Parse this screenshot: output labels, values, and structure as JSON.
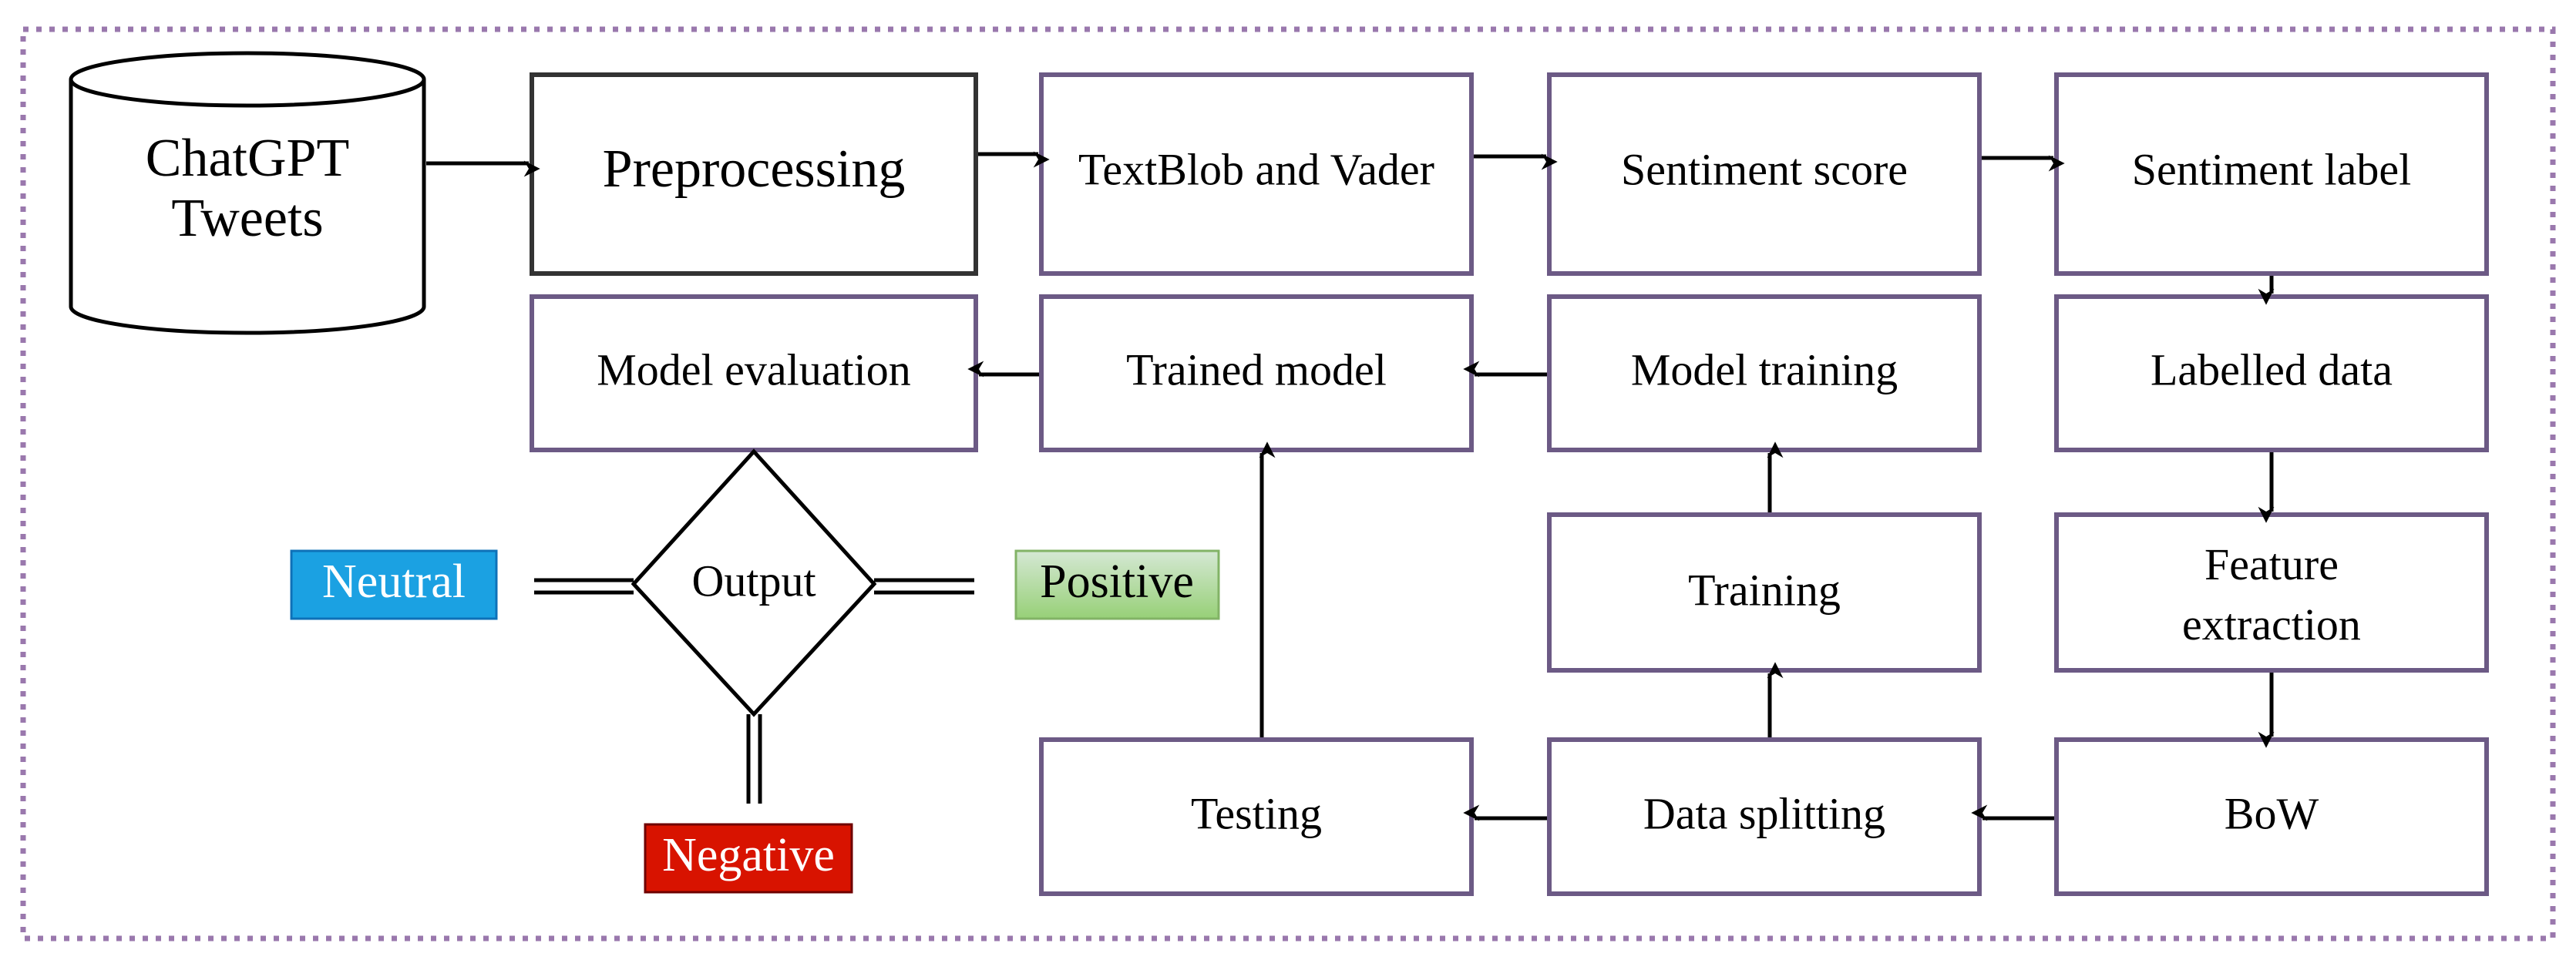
{
  "colors": {
    "frame_dotted": "#9a78ad",
    "box_border": "#6c5a85",
    "neutral": "#1ba1e2",
    "positive": "#a3d384",
    "negative": "#d81300"
  },
  "nodes": {
    "source_line1": "ChatGPT",
    "source_line2": "Tweets",
    "preprocessing": "Preprocessing",
    "textblob_vader": "TextBlob and Vader",
    "sentiment_score": "Sentiment score",
    "sentiment_label": "Sentiment label",
    "labelled_data": "Labelled data",
    "feature_line1": "Feature",
    "feature_line2": "extraction",
    "bow": "BoW",
    "data_splitting": "Data splitting",
    "training": "Training",
    "testing": "Testing",
    "model_training": "Model training",
    "trained_model": "Trained model",
    "model_evaluation": "Model evaluation",
    "output": "Output"
  },
  "outputs": {
    "neutral": "Neutral",
    "positive": "Positive",
    "negative": "Negative"
  }
}
